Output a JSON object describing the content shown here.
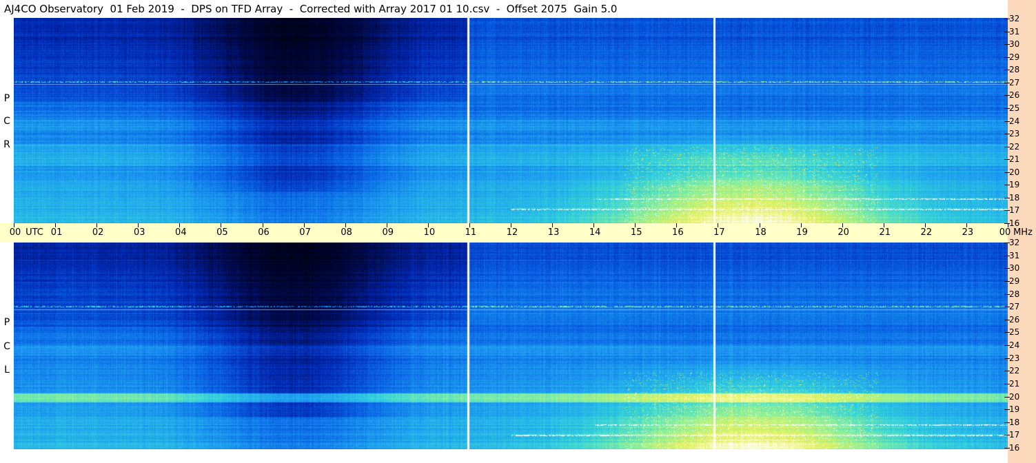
{
  "title": "AJ4CO Observatory  01 Feb 2019  -  DPS on TFD Array  -  Corrected with Array 2017 01 10.csv  -  Offset 2075  Gain 5.0",
  "chart_data": {
    "type": "heatmap",
    "title": "AJ4CO Observatory  01 Feb 2019  -  DPS on TFD Array  -  Corrected with Array 2017 01 10.csv  -  Offset 2075  Gain 5.0",
    "x_axis": {
      "unit_label": "UTC",
      "range": [
        0,
        24
      ],
      "tick_labels": [
        "00",
        "01",
        "02",
        "03",
        "04",
        "05",
        "06",
        "07",
        "08",
        "09",
        "10",
        "11",
        "12",
        "13",
        "14",
        "15",
        "16",
        "17",
        "18",
        "19",
        "20",
        "21",
        "22",
        "23",
        "00"
      ]
    },
    "y_axis": {
      "unit_label": "MHz",
      "range": [
        16,
        32
      ],
      "tick_labels": [
        "16",
        "17",
        "18",
        "19",
        "20",
        "21",
        "22",
        "23",
        "24",
        "25",
        "26",
        "27",
        "28",
        "29",
        "30",
        "31",
        "32"
      ]
    },
    "panels": [
      {
        "name": "R C P",
        "letters": [
          "P",
          "C",
          "R"
        ]
      },
      {
        "name": "L C P",
        "letters": [
          "P",
          "C",
          "L"
        ]
      }
    ],
    "colormap": [
      "#000014",
      "#000a4a",
      "#0028b4",
      "#0a64e6",
      "#1ea0f0",
      "#32d2dc",
      "#8cf098",
      "#e6f05a",
      "#ffffff"
    ]
  }
}
